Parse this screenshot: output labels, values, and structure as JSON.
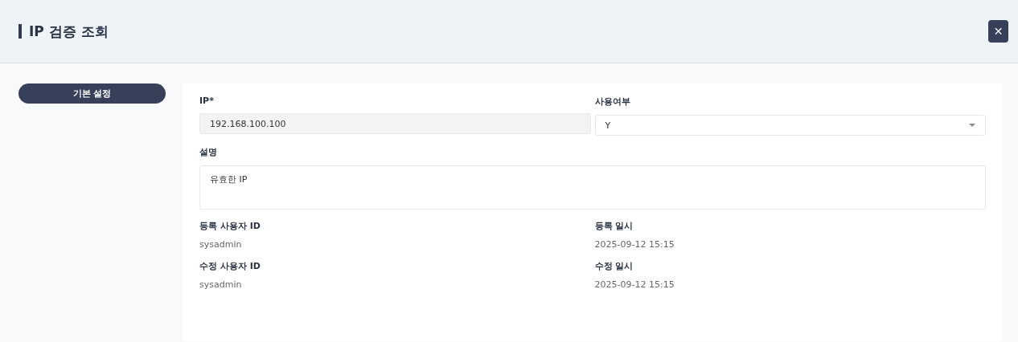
{
  "header": {
    "title": "IP 검증 조회",
    "close_label": "✕"
  },
  "sidebar": {
    "items": [
      {
        "label": "기본 설정",
        "selected": true
      }
    ]
  },
  "form": {
    "fields": [
      {
        "kind": "readonly",
        "label": "IP*",
        "value": "192.168.100.100",
        "wide": false
      },
      {
        "kind": "select",
        "label": "사용여부",
        "value": "Y",
        "wide": false
      },
      {
        "kind": "textarea",
        "label": "설명",
        "value": "유효한 IP",
        "wide": true
      },
      {
        "kind": "info",
        "label": "등록 사용자 ID",
        "value": "sysadmin",
        "wide": false
      },
      {
        "kind": "info",
        "label": "등록 일시",
        "value": "2025-09-12 15:15",
        "wide": false
      },
      {
        "kind": "info",
        "label": "수정 사용자 ID",
        "value": "sysadmin",
        "wide": false
      },
      {
        "kind": "info",
        "label": "수정 일시",
        "value": "2025-09-12 15:15",
        "wide": false
      }
    ]
  }
}
